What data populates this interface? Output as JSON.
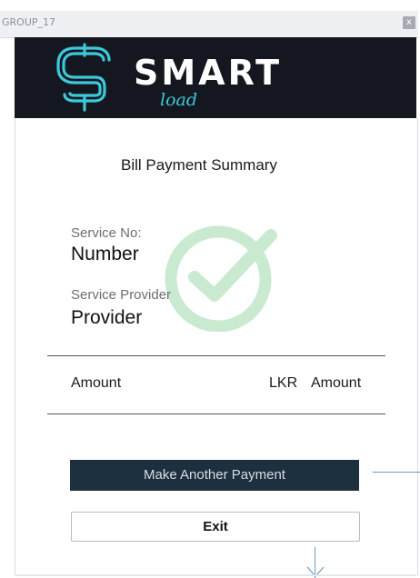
{
  "window": {
    "title": "GROUP_17",
    "close_symbol": "x"
  },
  "brand": {
    "name": "SMART",
    "tagline": "load",
    "logo_icon": "dollar-s-logo-icon"
  },
  "summary": {
    "title": "Bill Payment Summary",
    "service_no_label": "Service No:",
    "service_no_value": "Number",
    "provider_label": "Service Provider",
    "provider_value": "Provider",
    "amount_label": "Amount",
    "currency": "LKR",
    "amount_value": "Amount"
  },
  "actions": {
    "make_another": "Make Another Payment",
    "exit": "Exit"
  },
  "colors": {
    "header_bg": "#14171f",
    "brand_accent": "#3cc9da",
    "watermark": "#c9ead0",
    "primary_button": "#1d3040",
    "connector": "#6d9ac0"
  }
}
